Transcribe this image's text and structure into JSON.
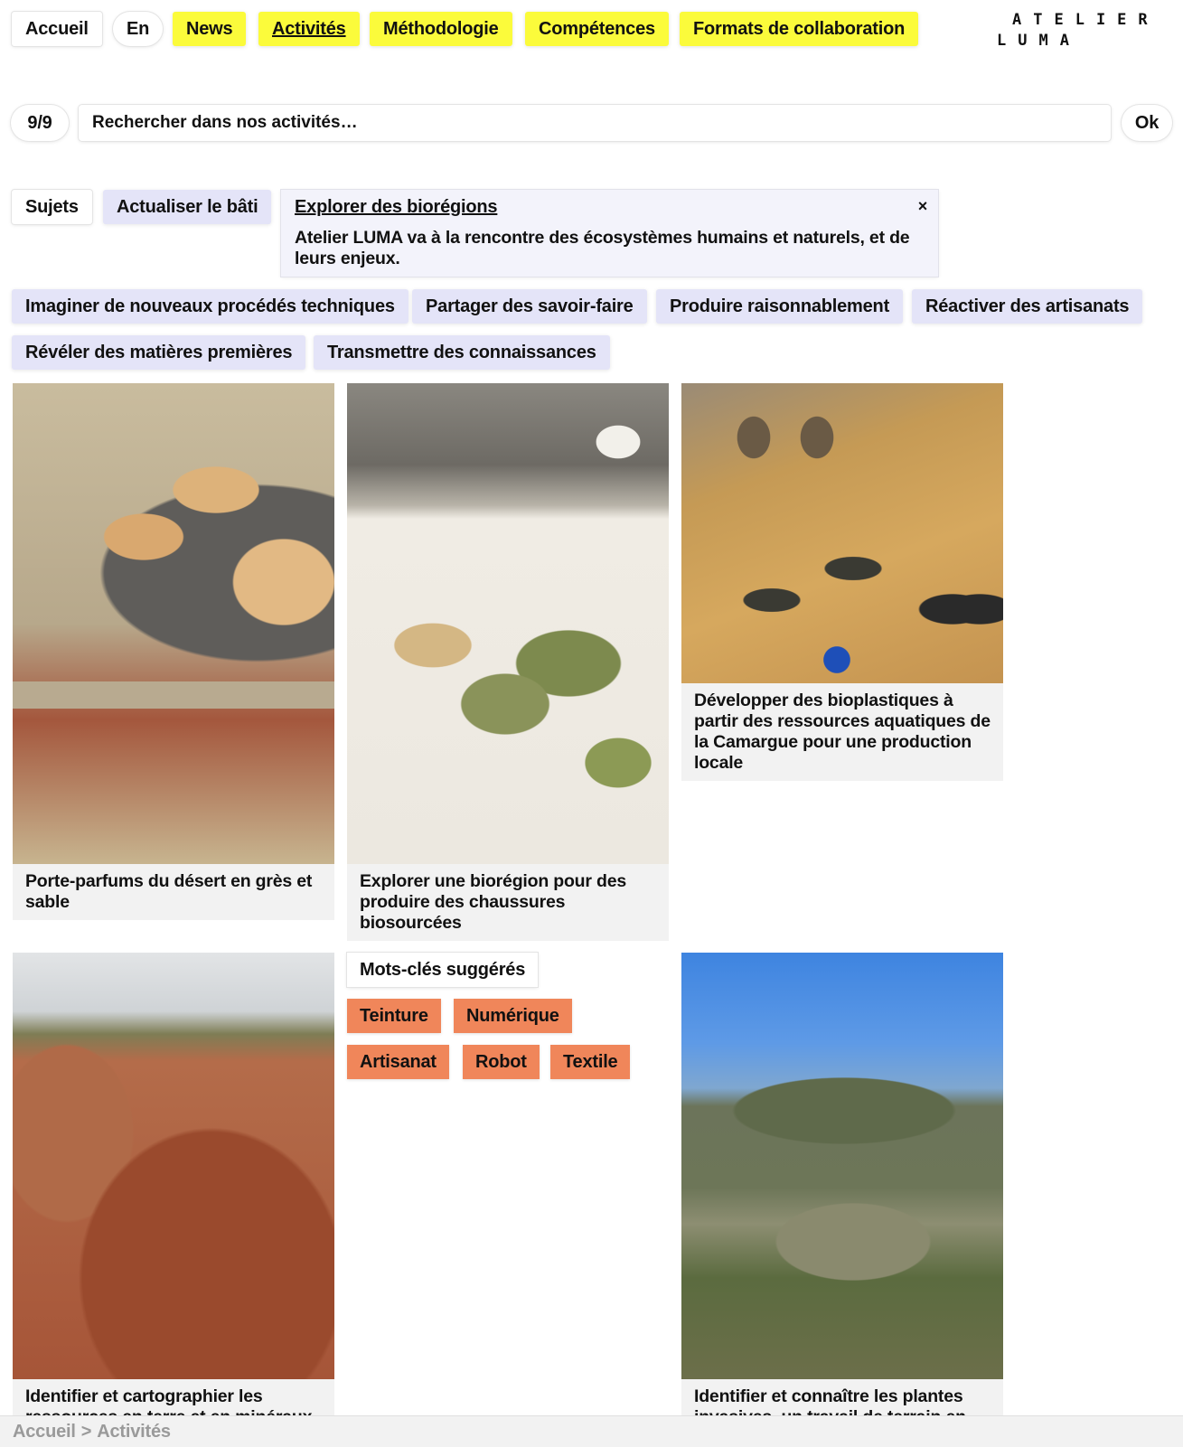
{
  "nav": {
    "home": "Accueil",
    "lang": "En",
    "items": [
      "News",
      "Activités",
      "Méthodologie",
      "Compétences",
      "Formats de collaboration"
    ],
    "active": "Activités",
    "colors": {
      "nav_yellow": "#fbfb3b",
      "topic_lavender": "#e4e4f8",
      "keyword_orange": "#f0865a"
    }
  },
  "logo": {
    "line1": "ATELIER",
    "line2": "LUMA"
  },
  "search": {
    "count": "9/9",
    "placeholder": "Rechercher dans nos activités…",
    "submit": "Ok"
  },
  "topics": {
    "label": "Sujets",
    "items": [
      "Actualiser le bâti",
      "Imaginer de nouveaux procédés techniques",
      "Partager des savoir-faire",
      "Produire raisonnablement",
      "Réactiver des artisanats",
      "Révéler des matières premières",
      "Transmettre des connaissances"
    ],
    "active": {
      "title": "Explorer des biorégions",
      "description": "Atelier LUMA va à la rencontre des écosystèmes humains et naturels, et de leurs enjeux.",
      "close": "×"
    }
  },
  "cards": [
    {
      "caption": "Porte-parfums du désert en grès et sable"
    },
    {
      "caption": "Explorer une biorégion pour des produire des chaussures biosourcées"
    },
    {
      "caption": "Développer des bioplastiques à partir des ressources aquatiques de la Camargue pour une production locale"
    },
    {
      "caption": "Identifier et cartographier les ressources en terre et en minéraux"
    },
    {
      "caption": "Identifier et connaître les plantes invasives, un travail de terrain en"
    }
  ],
  "keywords": {
    "title": "Mots-clés suggérés",
    "items": [
      "Teinture",
      "Numérique",
      "Artisanat",
      "Robot",
      "Textile"
    ]
  },
  "breadcrumb": {
    "items": [
      "Accueil",
      "Activités"
    ],
    "separator": ">"
  }
}
